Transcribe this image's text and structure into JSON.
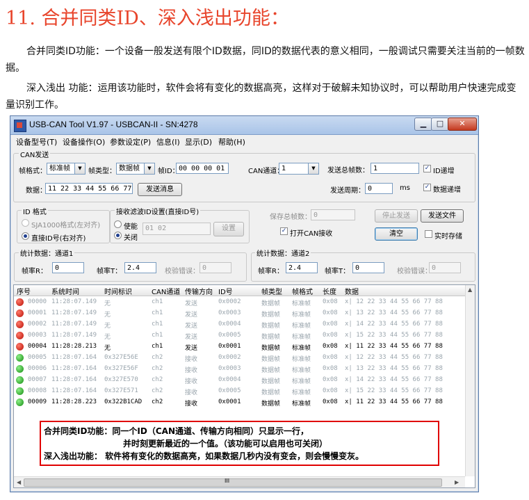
{
  "doc": {
    "title": "11. 合并同类ID、深入浅出功能：",
    "para1": "合并同类ID功能：一个设备一般发送有限个ID数据，同ID的数据代表的意义相同，一般调试只需要关注当前的一帧数据。",
    "para2": "深入浅出 功能：运用该功能时，软件会将有变化的数据高亮，这样对于破解未知协议时，可以帮助用户快速完成变量识别工作。"
  },
  "window": {
    "title": "USB-CAN Tool V1.97 - USBCAN-II - SN:4278",
    "min_glyph": "▁",
    "max_glyph": "□",
    "close_glyph": "✕"
  },
  "menu": [
    "设备型号(T)",
    "设备操作(O)",
    "参数设定(P)",
    "信息(I)",
    "显示(D)",
    "帮助(H)"
  ],
  "send": {
    "group_label": "CAN发送",
    "frame_format_label": "帧格式：",
    "frame_format_value": "标准帧",
    "frame_type_label": "帧类型：",
    "frame_type_value": "数据帧",
    "frame_id_label": "帧ID：",
    "frame_id_value": "00 00 00 01",
    "channel_label": "CAN通道：",
    "channel_value": "1",
    "total_label": "发送总帧数：",
    "total_value": "1",
    "id_inc_label": "ID递增",
    "data_label": "数据：",
    "data_value": "11 22 33 44 55 66 77 88",
    "send_button": "发送消息",
    "period_label": "发送周期：",
    "period_value": "0",
    "period_unit": "ms",
    "data_inc_label": "数据递增",
    "check_mark": "✓"
  },
  "id_format": {
    "group_label": "ID 格式",
    "opt1": "SJA1000格式(左对齐)",
    "opt2": "直接ID号(右对齐)"
  },
  "filter": {
    "group_label": "接收滤波ID设置(直接ID号)",
    "enable": "使能",
    "disable": "关闭",
    "value": "01 02",
    "set_button": "设置"
  },
  "save": {
    "total_label": "保存总帧数：",
    "total_value": "0",
    "open_recv_label": "打开CAN接收",
    "stop_button": "停止发送",
    "send_file_button": "发送文件",
    "clear_button": "清空",
    "realtime_label": "实时存储"
  },
  "stats": [
    {
      "group_label": "统计数据：通道1",
      "rx_label": "帧率R：",
      "rx_value": "0",
      "tx_label": "帧率T：",
      "tx_value": "2.4",
      "err_label": "校验错误：",
      "err_value": "0"
    },
    {
      "group_label": "统计数据：通道2",
      "rx_label": "帧率R：",
      "rx_value": "2.4",
      "tx_label": "帧率T：",
      "tx_value": "0",
      "err_label": "校验错误：",
      "err_value": "0"
    }
  ],
  "list": {
    "headers": [
      "序号",
      "系统时间",
      "时间标识",
      "CAN通道",
      "传输方向",
      "ID号",
      "帧类型",
      "帧格式",
      "长度",
      "数据"
    ],
    "rows": [
      {
        "color": "red",
        "state": "dim",
        "cells": [
          "00000",
          "11:28:07.149",
          "无",
          "ch1",
          "发送",
          "0x0002",
          "数据帧",
          "标准帧",
          "0x08",
          "x| 12 22 33 44 55 66 77 88"
        ]
      },
      {
        "color": "red",
        "state": "dim",
        "cells": [
          "00001",
          "11:28:07.149",
          "无",
          "ch1",
          "发送",
          "0x0003",
          "数据帧",
          "标准帧",
          "0x08",
          "x| 13 22 33 44 55 66 77 88"
        ]
      },
      {
        "color": "red",
        "state": "dim",
        "cells": [
          "00002",
          "11:28:07.149",
          "无",
          "ch1",
          "发送",
          "0x0004",
          "数据帧",
          "标准帧",
          "0x08",
          "x| 14 22 33 44 55 66 77 88"
        ]
      },
      {
        "color": "red",
        "state": "dim",
        "cells": [
          "00003",
          "11:28:07.149",
          "无",
          "ch1",
          "发送",
          "0x0005",
          "数据帧",
          "标准帧",
          "0x08",
          "x| 15 22 33 44 55 66 77 88"
        ]
      },
      {
        "color": "red",
        "state": "hi",
        "cells": [
          "00004",
          "11:28:28.213",
          "无",
          "ch1",
          "发送",
          "0x0001",
          "数据帧",
          "标准帧",
          "0x08",
          "x| 11 22 33 44 55 66 77 88"
        ]
      },
      {
        "color": "green",
        "state": "dim",
        "cells": [
          "00005",
          "11:28:07.164",
          "0x327E56E",
          "ch2",
          "接收",
          "0x0002",
          "数据帧",
          "标准帧",
          "0x08",
          "x| 12 22 33 44 55 66 77 88"
        ]
      },
      {
        "color": "green",
        "state": "dim",
        "cells": [
          "00006",
          "11:28:07.164",
          "0x327E56F",
          "ch2",
          "接收",
          "0x0003",
          "数据帧",
          "标准帧",
          "0x08",
          "x| 13 22 33 44 55 66 77 88"
        ]
      },
      {
        "color": "green",
        "state": "dim",
        "cells": [
          "00007",
          "11:28:07.164",
          "0x327E570",
          "ch2",
          "接收",
          "0x0004",
          "数据帧",
          "标准帧",
          "0x08",
          "x| 14 22 33 44 55 66 77 88"
        ]
      },
      {
        "color": "green",
        "state": "dim",
        "cells": [
          "00008",
          "11:28:07.164",
          "0x327E571",
          "ch2",
          "接收",
          "0x0005",
          "数据帧",
          "标准帧",
          "0x08",
          "x| 15 22 33 44 55 66 77 88"
        ]
      },
      {
        "color": "green",
        "state": "hi",
        "cells": [
          "00009",
          "11:28:28.223",
          "0x322B1CAD",
          "ch2",
          "接收",
          "0x0001",
          "数据帧",
          "标准帧",
          "0x08",
          "x| 11 22 33 44 55 66 77 88"
        ]
      }
    ],
    "scroll_thumb": "III"
  },
  "callout": {
    "line1": "合并同类ID功能：同一个ID（CAN通道、传输方向相同）只显示一行，",
    "line2": "并时刻更新最近的一个值。（该功能可以启用也可关闭）",
    "line3": "深入浅出功能：   软件将有变化的数据高亮，如果数据几秒内没有变会，则会慢慢变灰。"
  }
}
